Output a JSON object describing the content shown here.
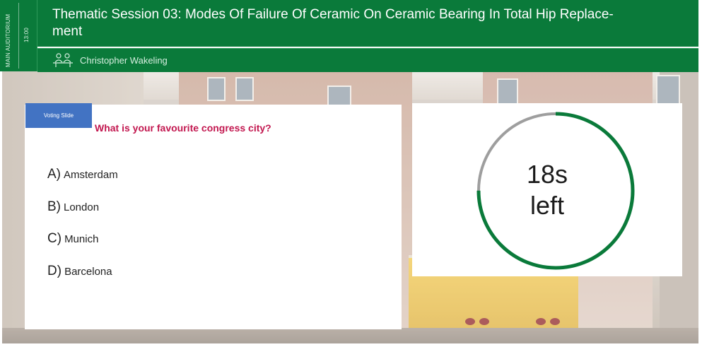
{
  "session": {
    "room": "MAIN AUDITORIUM",
    "time": "13:00",
    "title": "Thematic Session 03: Modes Of Failure Of Ceramic On Ceramic Bearing In Total Hip Replace-ment",
    "speaker": "Christopher Wakeling"
  },
  "poll": {
    "tag": "Voting Slide",
    "question": "What is your favourite congress city?",
    "answers": [
      {
        "letter": "A)",
        "text": "Amsterdam"
      },
      {
        "letter": "B)",
        "text": "London"
      },
      {
        "letter": "C)",
        "text": "Munich"
      },
      {
        "letter": "D)",
        "text": "Barcelona"
      }
    ]
  },
  "timer": {
    "value": "18s",
    "label": "left",
    "remaining_fraction": 0.75,
    "colors": {
      "remaining": "#0a7a3a",
      "elapsed": "#9e9e9e"
    }
  },
  "colors": {
    "brand": "#0a7a3a",
    "question": "#c2174f",
    "tag": "#4273c3"
  },
  "icons": {
    "speaker": "podium-speakers-icon"
  }
}
